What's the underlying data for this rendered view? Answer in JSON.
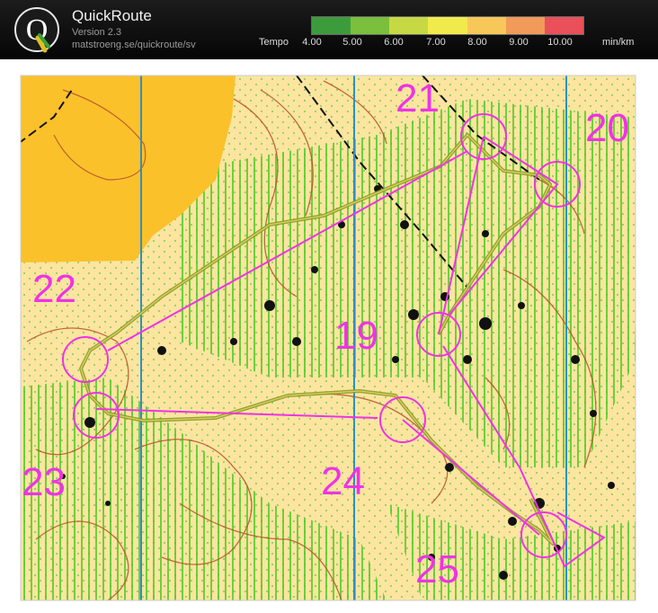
{
  "app": {
    "title": "QuickRoute",
    "version": "Version 2.3",
    "url": "matstroeng.se/quickroute/sv"
  },
  "tempo": {
    "label": "Tempo",
    "ticks": [
      "4.00",
      "5.00",
      "6.00",
      "7.00",
      "8.00",
      "9.00",
      "10.00"
    ],
    "unit": "min/km",
    "scale_colors": [
      "#3c9c3c",
      "#7bbf3c",
      "#c6d944",
      "#f1ea4c",
      "#f7c75a",
      "#f19a5a",
      "#e9505a"
    ]
  },
  "map": {
    "controls": [
      "19",
      "20",
      "21",
      "22",
      "23",
      "24",
      "25"
    ]
  },
  "colors": {
    "course": "#ef33e4",
    "meridian": "#2f8fc2",
    "route": "#8c9a2c",
    "open_land": "#fde5a0",
    "field": "#fbc12a",
    "vegetation_stripe": "#6fcf3c"
  }
}
